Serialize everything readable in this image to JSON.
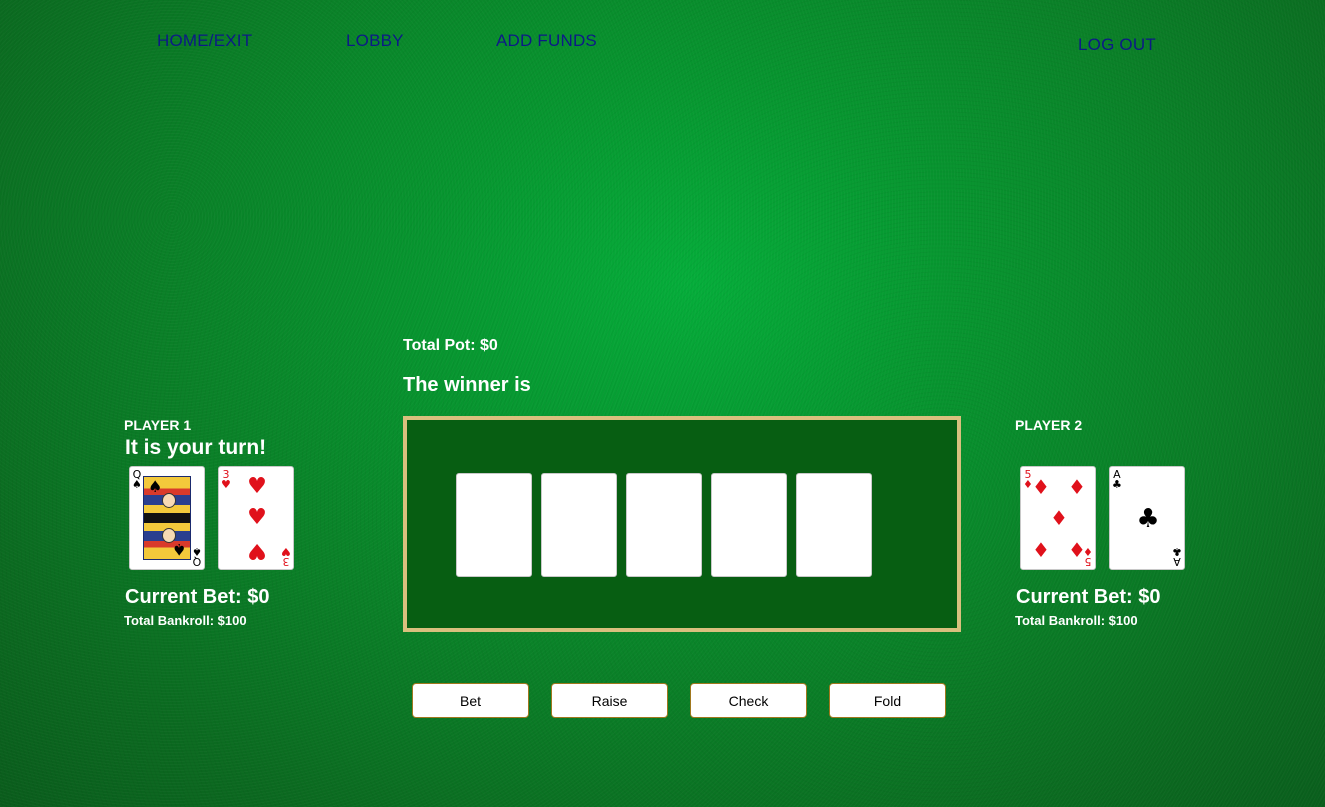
{
  "nav": {
    "home": "HOME/EXIT",
    "lobby": "LOBBY",
    "add_funds": "ADD FUNDS",
    "logout": "LOG OUT"
  },
  "table": {
    "total_pot": "Total Pot: $0",
    "winner": "The winner is",
    "community_cards": [
      "",
      "",
      "",
      "",
      ""
    ]
  },
  "player1": {
    "name": "PLAYER 1",
    "status": "It is your turn!",
    "current_bet": "Current Bet: $0",
    "bankroll": "Total Bankroll: $100",
    "cards": [
      {
        "rank": "Q",
        "suit": "♠",
        "color": "black"
      },
      {
        "rank": "3",
        "suit": "♥",
        "color": "red"
      }
    ]
  },
  "player2": {
    "name": "PLAYER 2",
    "current_bet": "Current Bet: $0",
    "bankroll": "Total Bankroll: $100",
    "cards": [
      {
        "rank": "5",
        "suit": "♦",
        "color": "red"
      },
      {
        "rank": "A",
        "suit": "♣",
        "color": "black"
      }
    ]
  },
  "actions": {
    "bet": "Bet",
    "raise": "Raise",
    "check": "Check",
    "fold": "Fold"
  },
  "colors": {
    "felt": "#079430",
    "board": "#075e12",
    "board_border": "#d9c07e",
    "nav_text": "#0d1a86",
    "button_border": "#a0781e"
  }
}
